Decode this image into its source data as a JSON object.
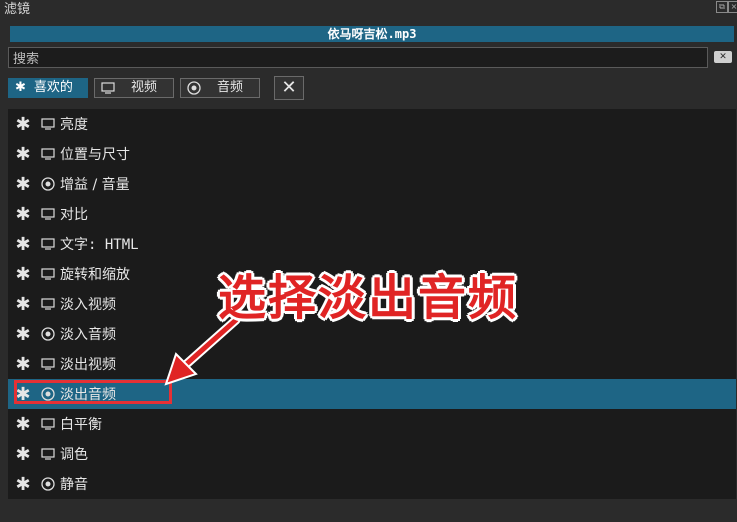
{
  "window": {
    "title": "滤镜"
  },
  "file": {
    "name": "依马呀吉松.mp3"
  },
  "search": {
    "placeholder": "搜索"
  },
  "tabs": [
    {
      "label": "喜欢的",
      "icon": "star-icon",
      "active": true
    },
    {
      "label": "视频",
      "icon": "monitor-icon",
      "active": false
    },
    {
      "label": "音频",
      "icon": "audio-disc-icon",
      "active": false
    }
  ],
  "filters": [
    {
      "label": "亮度",
      "type": "video"
    },
    {
      "label": "位置与尺寸",
      "type": "video"
    },
    {
      "label": "增益 / 音量",
      "type": "audio"
    },
    {
      "label": "对比",
      "type": "video"
    },
    {
      "label": "文字: HTML",
      "type": "video"
    },
    {
      "label": "旋转和缩放",
      "type": "video"
    },
    {
      "label": "淡入视频",
      "type": "video"
    },
    {
      "label": "淡入音频",
      "type": "audio"
    },
    {
      "label": "淡出视频",
      "type": "video"
    },
    {
      "label": "淡出音频",
      "type": "audio",
      "selected": true
    },
    {
      "label": "白平衡",
      "type": "video"
    },
    {
      "label": "调色",
      "type": "video"
    },
    {
      "label": "静音",
      "type": "audio"
    }
  ],
  "annotation": {
    "text": "选择淡出音频",
    "color": "#e02424"
  },
  "colors": {
    "accent": "#1e6585",
    "panel": "#2b2b2b",
    "list": "#1b1b1b"
  }
}
